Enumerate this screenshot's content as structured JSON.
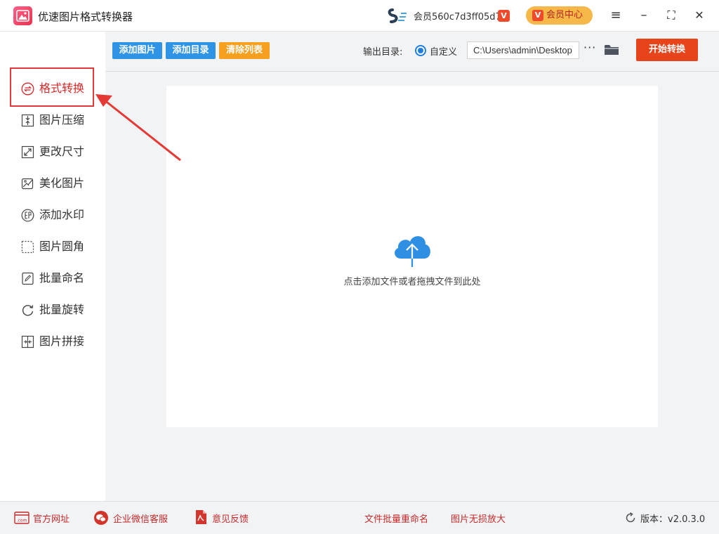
{
  "app": {
    "title": "优速图片格式转换器",
    "user_text": "会员560c7d3ff05d7",
    "v_badge": "V",
    "vip_label": "会员中心"
  },
  "window_controls": {
    "menu": "≡",
    "minimize": "–",
    "maximize": "⛶",
    "close": "✕"
  },
  "sidebar": {
    "items": [
      {
        "label": "格式转换",
        "icon": "convert-icon",
        "active": true
      },
      {
        "label": "图片压缩",
        "icon": "compress-icon"
      },
      {
        "label": "更改尺寸",
        "icon": "resize-icon"
      },
      {
        "label": "美化图片",
        "icon": "beautify-icon"
      },
      {
        "label": "添加水印",
        "icon": "watermark-icon"
      },
      {
        "label": "图片圆角",
        "icon": "rounded-corner-icon"
      },
      {
        "label": "批量命名",
        "icon": "rename-icon"
      },
      {
        "label": "批量旋转",
        "icon": "rotate-icon"
      },
      {
        "label": "图片拼接",
        "icon": "stitch-icon"
      }
    ]
  },
  "toolbar": {
    "add_image": "添加图片",
    "add_dir": "添加目录",
    "clear_list": "清除列表",
    "output_label": "输出目录:",
    "radio_label": "自定义",
    "path_value": "C:\\Users\\admin\\Desktop",
    "more": "···",
    "start": "开始转换"
  },
  "main": {
    "drop_hint": "点击添加文件或者拖拽文件到此处"
  },
  "footer": {
    "website": "官方网址",
    "wechat": "企业微信客服",
    "feedback": "意见反馈",
    "batch_rename": "文件批量重命名",
    "upscale": "图片无损放大",
    "version": "版本：v2.0.3.0"
  },
  "colors": {
    "accent_blue": "#2f93e6",
    "accent_orange": "#f5a01f",
    "start_red": "#e8441c",
    "active_red": "#d62828"
  }
}
